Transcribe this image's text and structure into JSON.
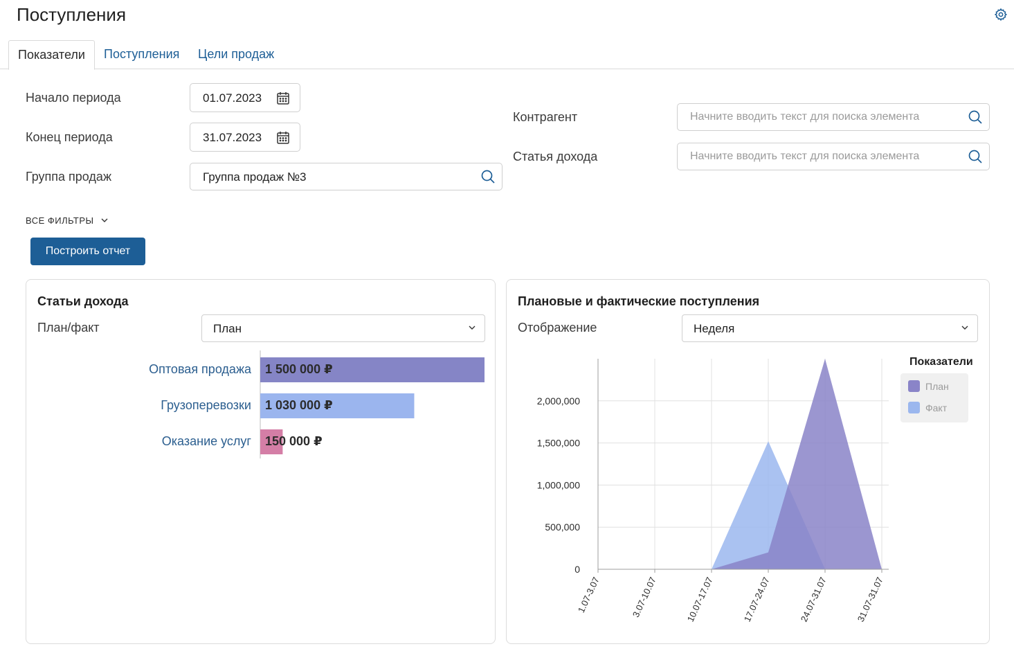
{
  "page": {
    "title": "Поступления"
  },
  "tabs": [
    {
      "label": "Показатели",
      "active": true
    },
    {
      "label": "Поступления",
      "active": false
    },
    {
      "label": "Цели продаж",
      "active": false
    }
  ],
  "filters": {
    "period_start": {
      "label": "Начало периода",
      "value": "01.07.2023"
    },
    "period_end": {
      "label": "Конец периода",
      "value": "31.07.2023"
    },
    "sales_group": {
      "label": "Группа продаж",
      "value": "Группа продаж №3"
    },
    "counterparty": {
      "label": "Контрагент",
      "placeholder": "Начните вводить текст для поиска элемента"
    },
    "income_item": {
      "label": "Статья дохода",
      "placeholder": "Начните вводить текст для поиска элемента"
    },
    "all_filters_label": "ВСЕ ФИЛЬТРЫ",
    "build_button": "Построить отчет"
  },
  "income_panel": {
    "title": "Статьи дохода",
    "selector_label": "План/факт",
    "selector_value": "План"
  },
  "flow_panel": {
    "title": "Плановые и фактические поступления",
    "selector_label": "Отображение",
    "selector_value": "Неделя"
  },
  "chart_data": [
    {
      "type": "bar",
      "orientation": "horizontal",
      "categories": [
        "Оптовая продажа",
        "Грузоперевозки",
        "Оказание услуг"
      ],
      "values": [
        1500000,
        1030000,
        150000
      ],
      "value_labels": [
        "1 500 000 ₽",
        "1 030 000 ₽",
        "150 000 ₽"
      ],
      "colors": [
        "#8585c6",
        "#9bb5ee",
        "#d47ea6"
      ],
      "xlim": [
        0,
        1500000
      ]
    },
    {
      "type": "area",
      "x": [
        "1.07-3.07",
        "3.07-10.07",
        "10.07-17.07",
        "17.07-24.07",
        "24.07-31.07",
        "31.07-31.07"
      ],
      "series": [
        {
          "name": "План",
          "values": [
            0,
            0,
            0,
            200000,
            2500000,
            0
          ],
          "color": "#8a84c8"
        },
        {
          "name": "Факт",
          "values": [
            0,
            0,
            0,
            1520000,
            0,
            0
          ],
          "color": "#9bb7ee"
        }
      ],
      "ylim": [
        0,
        2500000
      ],
      "yticks": [
        0,
        500000,
        1000000,
        1500000,
        2000000
      ],
      "ytick_labels": [
        "0",
        "500,000",
        "1,000,000",
        "1,500,000",
        "2,000,000"
      ],
      "legend_title": "Показатели",
      "legend_position": "top-right",
      "grid": true
    }
  ]
}
